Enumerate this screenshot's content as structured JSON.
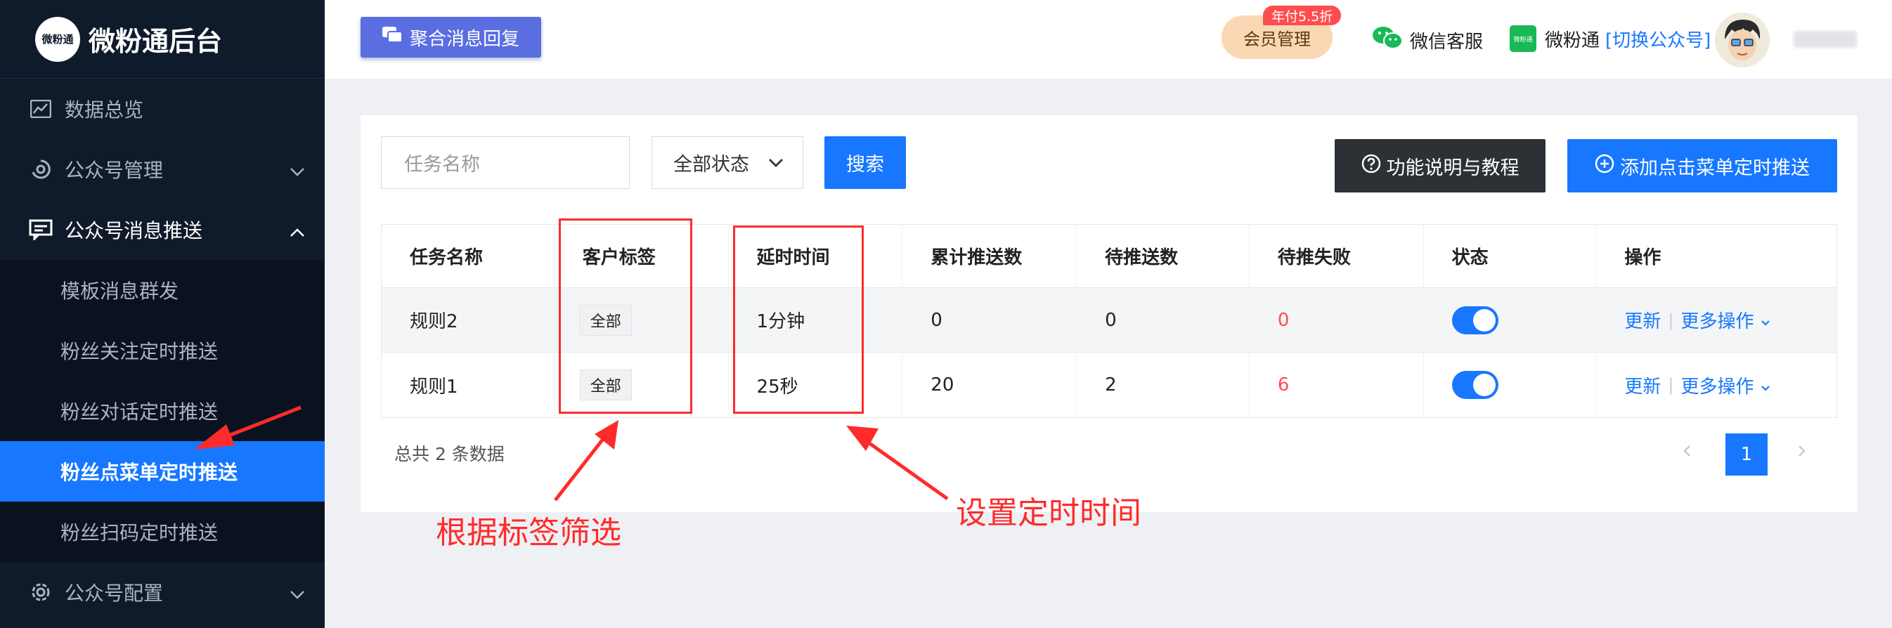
{
  "sidebar": {
    "logo_badge": "微粉通",
    "logo_text": "微粉通后台",
    "items": [
      {
        "label": "数据总览"
      },
      {
        "label": "公众号管理"
      },
      {
        "label": "公众号消息推送"
      }
    ],
    "sub_items": [
      {
        "label": "模板消息群发"
      },
      {
        "label": "粉丝关注定时推送"
      },
      {
        "label": "粉丝对话定时推送"
      },
      {
        "label": "粉丝点菜单定时推送"
      },
      {
        "label": "粉丝扫码定时推送"
      }
    ],
    "config_item": {
      "label": "公众号配置"
    },
    "active_sub_item": "粉丝点菜单定时推送"
  },
  "header": {
    "merge_button": "聚合消息回复",
    "vip_button": "会员管理",
    "vip_tag": "年付5.5折",
    "wechat_service": "微信客服",
    "wfs_icon_text": "微粉通",
    "wfs_name": "微粉通",
    "switch_account": "[切换公众号]"
  },
  "toolbar": {
    "task_name_placeholder": "任务名称",
    "status_select": "全部状态",
    "search_button": "搜索",
    "help_button": "功能说明与教程",
    "add_button": "添加点击菜单定时推送"
  },
  "table": {
    "headers": [
      "任务名称",
      "客户标签",
      "延时时间",
      "累计推送数",
      "待推送数",
      "待推失败",
      "状态",
      "操作"
    ],
    "rows": [
      {
        "name": "规则2",
        "tag": "全部",
        "delay": "1分钟",
        "total": "0",
        "pending": "0",
        "failed": "0",
        "status_on": true,
        "update": "更新",
        "more": "更多操作"
      },
      {
        "name": "规则1",
        "tag": "全部",
        "delay": "25秒",
        "total": "20",
        "pending": "2",
        "failed": "6",
        "status_on": true,
        "update": "更新",
        "more": "更多操作"
      }
    ]
  },
  "footer": {
    "total_text": "总共 2 条数据",
    "current_page": "1"
  },
  "annotations": {
    "tag_filter": "根据标签筛选",
    "set_time": "设置定时时间"
  },
  "colors": {
    "primary": "#1777ff",
    "sidebar_bg": "#0f1a2b",
    "annotation": "#ff2b2b",
    "danger": "#ff4d4f"
  }
}
